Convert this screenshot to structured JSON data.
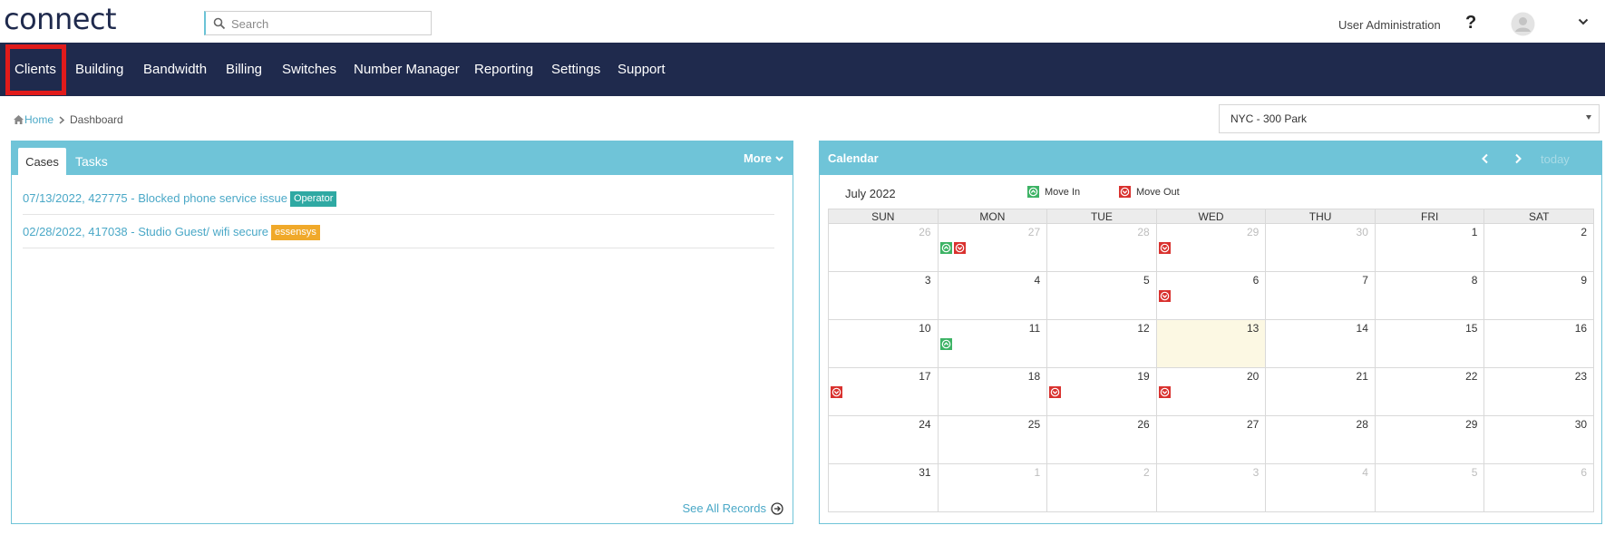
{
  "header": {
    "logo": "connect",
    "search_placeholder": "Search",
    "user_admin": "User Administration",
    "help": "?"
  },
  "nav": {
    "items": [
      "Clients",
      "Building",
      "Bandwidth",
      "Billing",
      "Switches",
      "Number Manager",
      "Reporting",
      "Settings",
      "Support"
    ],
    "highlighted": "Clients"
  },
  "breadcrumb": {
    "home": "Home",
    "current": "Dashboard"
  },
  "building_select": {
    "value": "NYC - 300 Park"
  },
  "cases_panel": {
    "tabs": [
      "Cases",
      "Tasks"
    ],
    "active_tab": "Cases",
    "more_label": "More",
    "rows": [
      {
        "text": "07/13/2022, 427775 - Blocked phone service issue",
        "badge": "Operator",
        "badge_color": "#2fa9a3"
      },
      {
        "text": "02/28/2022, 417038 - Studio Guest/ wifi secure",
        "badge": "essensys",
        "badge_color": "#f0a92a"
      }
    ],
    "see_all": "See All Records"
  },
  "calendar": {
    "title": "Calendar",
    "today_label": "today",
    "month_label": "July 2022",
    "legend": {
      "move_in": "Move In",
      "move_out": "Move Out"
    },
    "colors": {
      "move_in": "#3db365",
      "move_out": "#d9322f",
      "today_bg": "#fcf8e3"
    },
    "weekdays": [
      "SUN",
      "MON",
      "TUE",
      "WED",
      "THU",
      "FRI",
      "SAT"
    ],
    "weeks": [
      [
        {
          "d": "26",
          "o": true,
          "e": []
        },
        {
          "d": "27",
          "o": true,
          "e": [
            "in",
            "out"
          ]
        },
        {
          "d": "28",
          "o": true,
          "e": []
        },
        {
          "d": "29",
          "o": true,
          "e": [
            "out"
          ]
        },
        {
          "d": "30",
          "o": true,
          "e": []
        },
        {
          "d": "1",
          "o": false,
          "e": []
        },
        {
          "d": "2",
          "o": false,
          "e": []
        }
      ],
      [
        {
          "d": "3",
          "o": false,
          "e": []
        },
        {
          "d": "4",
          "o": false,
          "e": []
        },
        {
          "d": "5",
          "o": false,
          "e": []
        },
        {
          "d": "6",
          "o": false,
          "e": [
            "out"
          ]
        },
        {
          "d": "7",
          "o": false,
          "e": []
        },
        {
          "d": "8",
          "o": false,
          "e": []
        },
        {
          "d": "9",
          "o": false,
          "e": []
        }
      ],
      [
        {
          "d": "10",
          "o": false,
          "e": []
        },
        {
          "d": "11",
          "o": false,
          "e": [
            "in"
          ]
        },
        {
          "d": "12",
          "o": false,
          "e": []
        },
        {
          "d": "13",
          "o": false,
          "e": [],
          "today": true
        },
        {
          "d": "14",
          "o": false,
          "e": []
        },
        {
          "d": "15",
          "o": false,
          "e": []
        },
        {
          "d": "16",
          "o": false,
          "e": []
        }
      ],
      [
        {
          "d": "17",
          "o": false,
          "e": [
            "out"
          ]
        },
        {
          "d": "18",
          "o": false,
          "e": []
        },
        {
          "d": "19",
          "o": false,
          "e": [
            "out"
          ]
        },
        {
          "d": "20",
          "o": false,
          "e": [
            "out"
          ]
        },
        {
          "d": "21",
          "o": false,
          "e": []
        },
        {
          "d": "22",
          "o": false,
          "e": []
        },
        {
          "d": "23",
          "o": false,
          "e": []
        }
      ],
      [
        {
          "d": "24",
          "o": false,
          "e": []
        },
        {
          "d": "25",
          "o": false,
          "e": []
        },
        {
          "d": "26",
          "o": false,
          "e": []
        },
        {
          "d": "27",
          "o": false,
          "e": []
        },
        {
          "d": "28",
          "o": false,
          "e": []
        },
        {
          "d": "29",
          "o": false,
          "e": []
        },
        {
          "d": "30",
          "o": false,
          "e": []
        }
      ],
      [
        {
          "d": "31",
          "o": false,
          "e": []
        },
        {
          "d": "1",
          "o": true,
          "e": []
        },
        {
          "d": "2",
          "o": true,
          "e": []
        },
        {
          "d": "3",
          "o": true,
          "e": []
        },
        {
          "d": "4",
          "o": true,
          "e": []
        },
        {
          "d": "5",
          "o": true,
          "e": []
        },
        {
          "d": "6",
          "o": true,
          "e": []
        }
      ]
    ]
  }
}
